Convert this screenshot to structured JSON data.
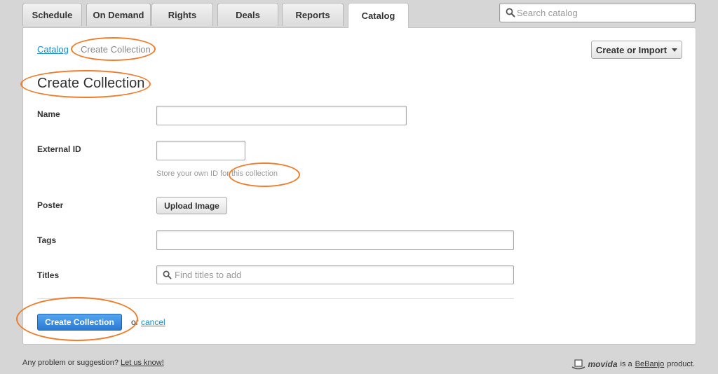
{
  "tabs": [
    {
      "label": "Schedule"
    },
    {
      "label": "On Demand"
    },
    {
      "label": "Rights"
    },
    {
      "label": "Deals"
    },
    {
      "label": "Reports"
    },
    {
      "label": "Catalog",
      "active": true
    }
  ],
  "search": {
    "placeholder": "Search catalog",
    "value": ""
  },
  "breadcrumb": {
    "parent": "Catalog",
    "current": "Create Collection"
  },
  "toolbar": {
    "create_import_label": "Create or Import"
  },
  "page": {
    "title": "Create Collection"
  },
  "form": {
    "name": {
      "label": "Name",
      "value": ""
    },
    "external_id": {
      "label": "External ID",
      "value": "",
      "hint": "Store your own ID for this collection"
    },
    "poster": {
      "label": "Poster",
      "button_label": "Upload Image"
    },
    "tags": {
      "label": "Tags",
      "value": ""
    },
    "titles": {
      "label": "Titles",
      "placeholder": "Find titles to add",
      "value": ""
    }
  },
  "actions": {
    "submit_label": "Create Collection",
    "or_text": "or",
    "cancel_label": "cancel"
  },
  "footer": {
    "problem_text": "Any problem or suggestion?",
    "feedback_link": "Let us know!",
    "brand": "movida",
    "is_a_text": "is a",
    "company_link": "BeBanjo",
    "product_text": "product."
  },
  "colors": {
    "accent_blue": "#2a79d3",
    "link": "#1b8fc7",
    "annotation_orange": "#ef7d2c",
    "background": "#d6d6d6"
  }
}
